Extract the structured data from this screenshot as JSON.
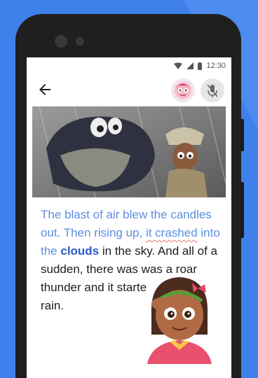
{
  "status": {
    "time": "12:30"
  },
  "appbar": {
    "back_icon": "arrow-back-icon",
    "avatar_icon": "reading-buddy-avatar-icon",
    "mic_icon": "mic-off-icon"
  },
  "story": {
    "seg1": "The blast of air blew the candles out. Then rising up, ",
    "seg2": "it crashed",
    "seg3": " into the ",
    "seg4": "clouds",
    "seg5": " in the sky. And all of a sudden, there was was a roar",
    "seg6": "thunder and it starte",
    "seg7": "rain."
  },
  "colors": {
    "background": "#3f80ea",
    "read_text": "#5b8fe0",
    "current_word": "#2a5cc8",
    "misread_underline": "#e57373"
  }
}
